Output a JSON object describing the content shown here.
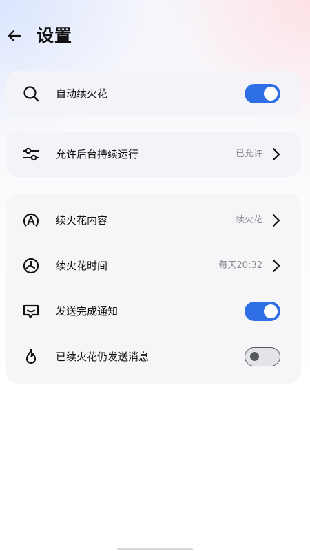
{
  "header": {
    "title": "设置",
    "back_icon": "arrow-left-icon"
  },
  "colors": {
    "accent": "#2f6fe6",
    "toggle_off_border": "#555a60",
    "value_text": "#8a8a8f"
  },
  "rows": {
    "auto_streak": {
      "label": "自动续火花",
      "icon": "search-icon",
      "toggle": "on"
    },
    "background_run": {
      "label": "允许后台持续运行",
      "value": "已允许",
      "icon": "sliders-icon"
    },
    "streak_content": {
      "label": "续火花内容",
      "value": "续火花",
      "icon": "letter-a-badge-icon"
    },
    "streak_time": {
      "label": "续火花时间",
      "value": "每天20:32",
      "icon": "clock-icon"
    },
    "notify": {
      "label": "发送完成通知",
      "icon": "message-bubble-icon",
      "toggle": "on"
    },
    "still_send": {
      "label": "已续火花仍发送消息",
      "icon": "flame-icon",
      "toggle": "off"
    }
  }
}
